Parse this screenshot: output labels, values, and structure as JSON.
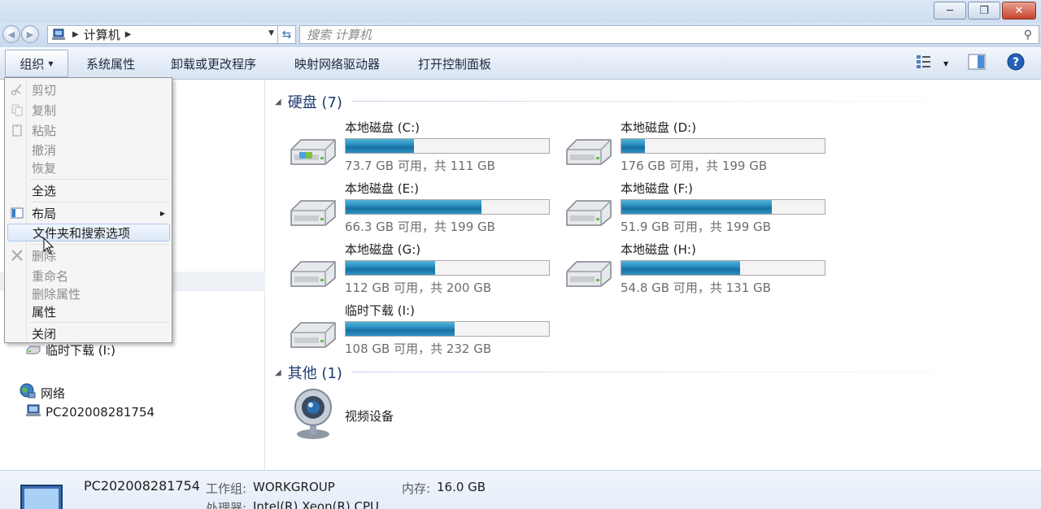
{
  "window": {
    "min_glyph": "─",
    "max_glyph": "❐",
    "close_glyph": "✕"
  },
  "address": {
    "path_item": "计算机",
    "search_placeholder": "搜索 计算机"
  },
  "toolbar": {
    "organize": "组织",
    "system_properties": "系统属性",
    "uninstall": "卸载或更改程序",
    "map_drive": "映射网络驱动器",
    "control_panel": "打开控制面板"
  },
  "menu": {
    "cut": "剪切",
    "copy": "复制",
    "paste": "粘贴",
    "undo": "撤消",
    "redo": "恢复",
    "select_all": "全选",
    "layout": "布局",
    "folder_options": "文件夹和搜索选项",
    "delete": "删除",
    "rename": "重命名",
    "remove_properties": "删除属性",
    "properties": "属性",
    "close": "关闭"
  },
  "nav": {
    "temp_download": "临时下载 (I:)",
    "network": "网络",
    "pc": "PC202008281754"
  },
  "groups": {
    "hard_disks": "硬盘 (7)",
    "other": "其他 (1)"
  },
  "drives": [
    {
      "name": "本地磁盘 (C:)",
      "free_text": "73.7 GB 可用，共 111 GB",
      "used_fraction": 0.336
    },
    {
      "name": "本地磁盘 (D:)",
      "free_text": "176 GB 可用，共 199 GB",
      "used_fraction": 0.116
    },
    {
      "name": "本地磁盘 (E:)",
      "free_text": "66.3 GB 可用，共 199 GB",
      "used_fraction": 0.667
    },
    {
      "name": "本地磁盘 (F:)",
      "free_text": "51.9 GB 可用，共 199 GB",
      "used_fraction": 0.739
    },
    {
      "name": "本地磁盘 (G:)",
      "free_text": "112 GB 可用，共 200 GB",
      "used_fraction": 0.44
    },
    {
      "name": "本地磁盘 (H:)",
      "free_text": "54.8 GB 可用，共 131 GB",
      "used_fraction": 0.582
    },
    {
      "name": "临时下载 (I:)",
      "free_text": "108 GB 可用，共 232 GB",
      "used_fraction": 0.534
    }
  ],
  "other_devices": [
    {
      "name": "视频设备"
    }
  ],
  "details": {
    "computer_name": "PC202008281754",
    "workgroup_label": "工作组:",
    "workgroup_value": "WORKGROUP",
    "memory_label": "内存:",
    "memory_value": "16.0 GB",
    "processor_label": "处理器:",
    "processor_value": "Intel(R) Xeon(R) CPU"
  },
  "colors": {
    "bar_fill": "#1a7fb3",
    "header_text": "#1e3a6e"
  }
}
